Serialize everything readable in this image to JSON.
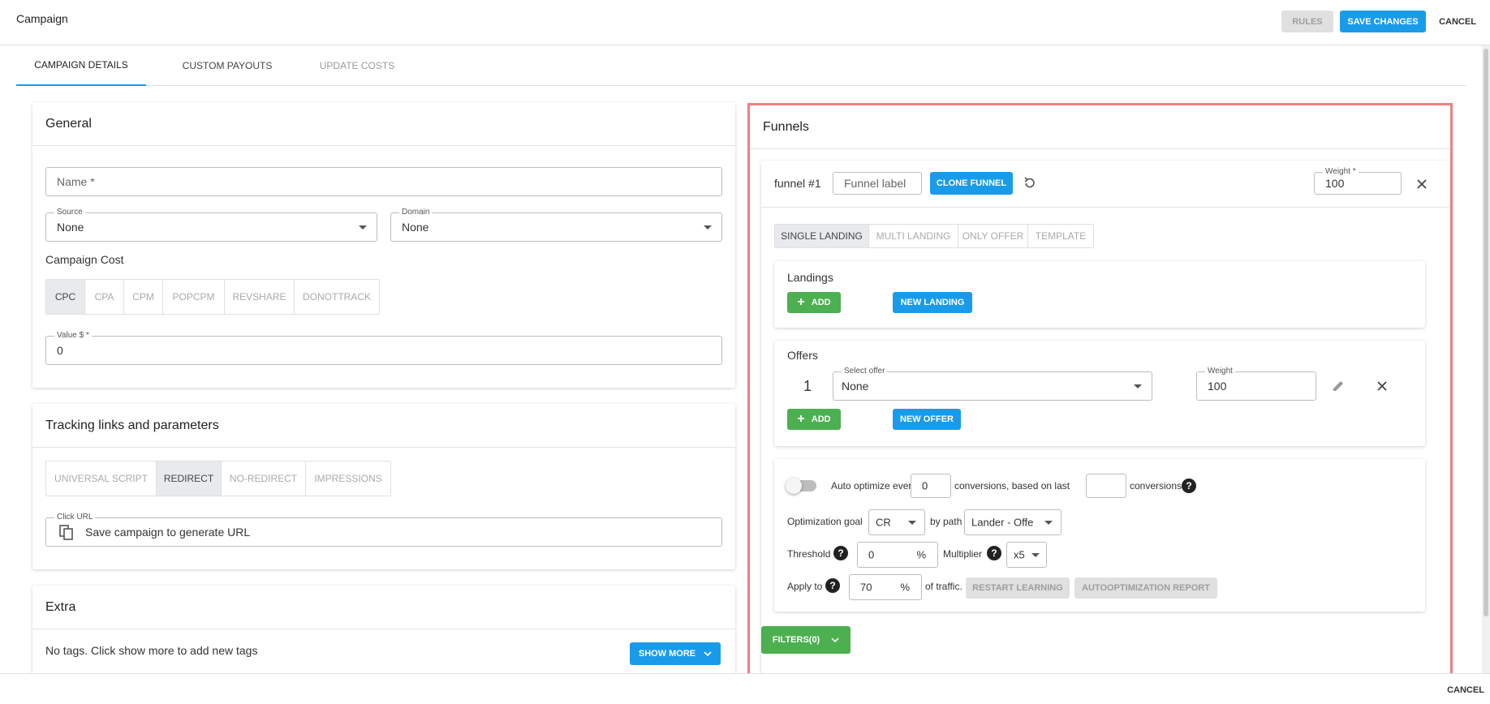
{
  "header": {
    "title": "Campaign",
    "rules_label": "RULES",
    "save_label": "SAVE CHANGES",
    "cancel_label": "CANCEL"
  },
  "tabs": [
    "CAMPAIGN DETAILS",
    "CUSTOM PAYOUTS",
    "UPDATE COSTS"
  ],
  "general": {
    "title": "General",
    "name_placeholder": "Name *",
    "source_label": "Source",
    "source_value": "None",
    "domain_label": "Domain",
    "domain_value": "None",
    "cost_label": "Campaign Cost",
    "cost_options": [
      "CPC",
      "CPA",
      "CPM",
      "POPCPM",
      "REVSHARE",
      "DONOTTRACK"
    ],
    "cost_selected": "CPC",
    "value_label": "Value $ *",
    "value": "0"
  },
  "tracking": {
    "title": "Tracking links and parameters",
    "options": [
      "UNIVERSAL SCRIPT",
      "REDIRECT",
      "NO-REDIRECT",
      "IMPRESSIONS"
    ],
    "selected": "REDIRECT",
    "click_url_label": "Click URL",
    "click_url_value": "Save campaign to generate URL"
  },
  "extra": {
    "title": "Extra",
    "tags_text": "No tags. Click show more to add new tags",
    "show_more_label": "SHOW MORE"
  },
  "funnels": {
    "title": "Funnels",
    "funnel_name": "funnel #1",
    "funnel_label_placeholder": "Funnel label",
    "clone_label": "CLONE FUNNEL",
    "weight_label": "Weight *",
    "weight_value": "100",
    "modes": [
      "SINGLE LANDING",
      "MULTI LANDING",
      "ONLY OFFER",
      "TEMPLATE"
    ],
    "mode_selected": "SINGLE LANDING",
    "landings": {
      "title": "Landings",
      "add_label": "ADD",
      "new_label": "NEW LANDING"
    },
    "offers": {
      "title": "Offers",
      "index": "1",
      "select_label": "Select offer",
      "select_value": "None",
      "weight_label": "Weight",
      "weight_value": "100",
      "add_label": "ADD",
      "new_label": "NEW OFFER"
    },
    "optimize": {
      "auto_text": "Auto optimize every",
      "every_value": "0",
      "based_text": "conversions, based on last",
      "last_value": "",
      "conversions_text": "conversions",
      "goal_label": "Optimization goal",
      "goal_value": "CR",
      "by_path_text": "by path",
      "path_value": "Lander - Offe",
      "threshold_label": "Threshold",
      "threshold_value": "0",
      "percent": "%",
      "multiplier_label": "Multiplier",
      "multiplier_value": "x5",
      "apply_label": "Apply to",
      "apply_value": "70",
      "traffic_text": "of traffic.",
      "restart_label": "RESTART LEARNING",
      "report_label": "AUTOOPTIMIZATION REPORT"
    },
    "filters_label": "FILTERS(0)"
  },
  "footer": {
    "cancel_label": "CANCEL"
  },
  "colors": {
    "accent": "#1a9be9",
    "success": "#4caf50",
    "highlight": "#f08080"
  }
}
